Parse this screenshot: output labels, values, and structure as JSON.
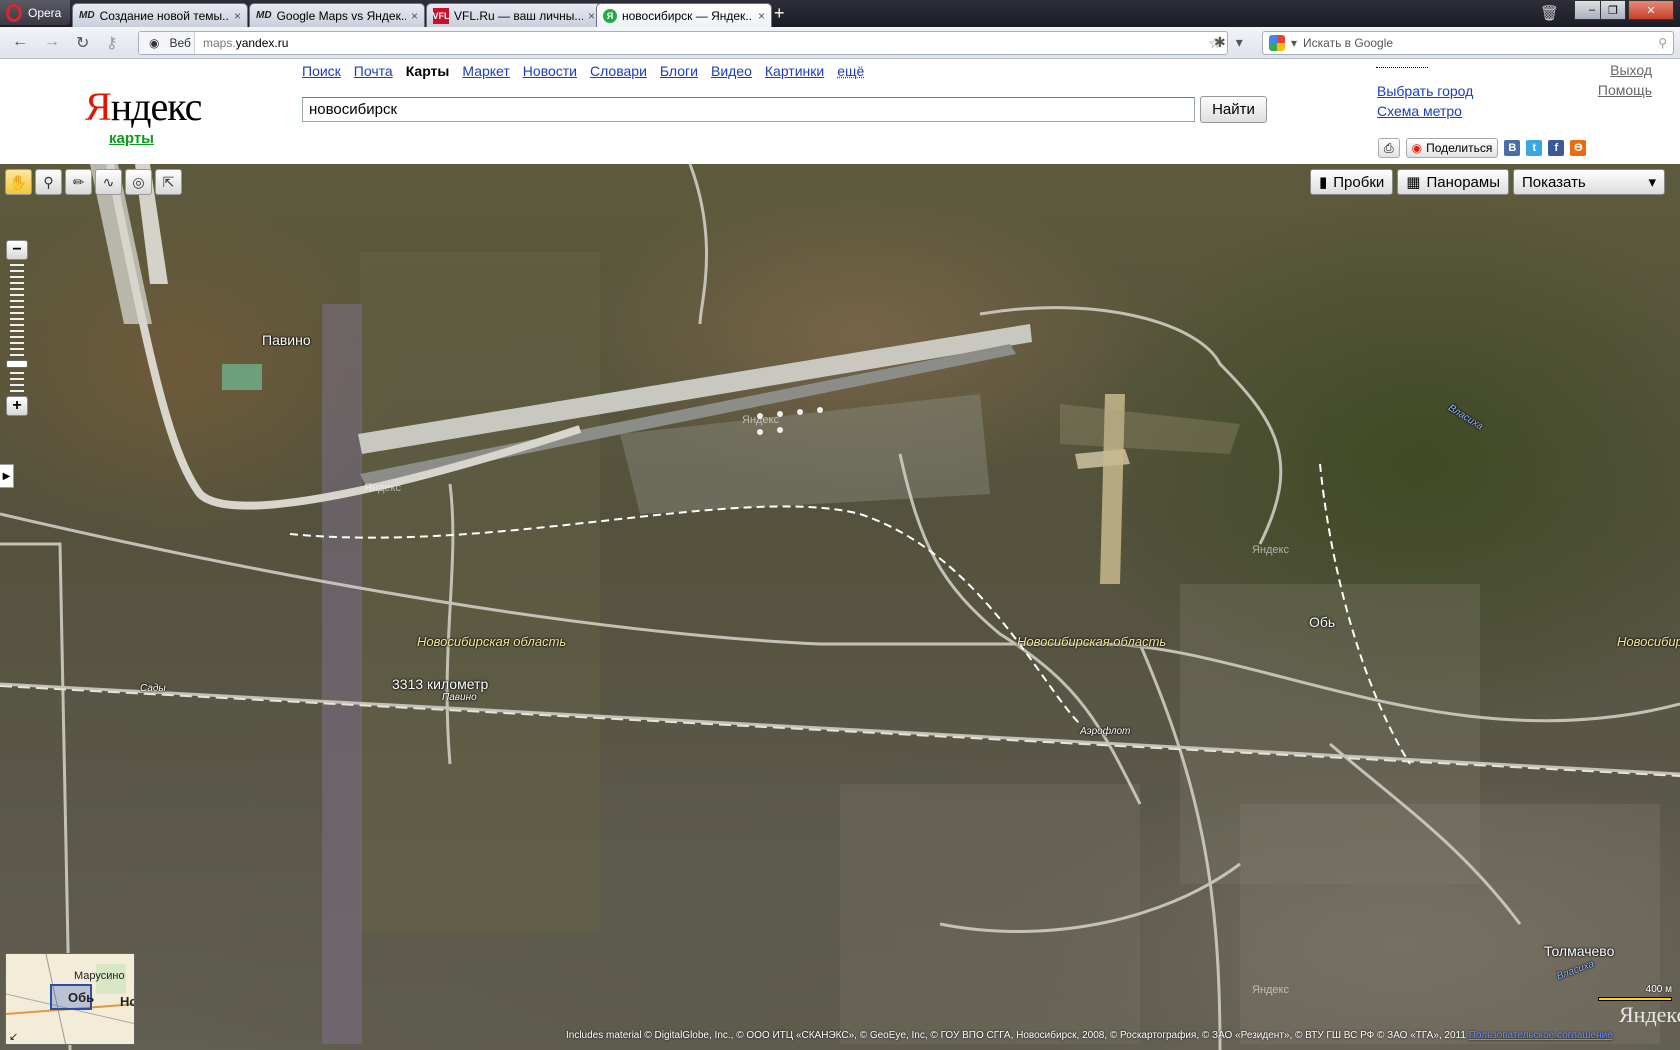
{
  "browser": {
    "menu_label": "Opera",
    "tabs": [
      {
        "icon": "MD",
        "title": "Создание новой темы...",
        "close": "×"
      },
      {
        "icon": "MD",
        "title": "Google Maps vs Яндек...",
        "close": "×"
      },
      {
        "icon": "VFL",
        "title": "VFL.Ru — ваш личны...",
        "close": "×"
      },
      {
        "icon": "Я",
        "title": "новосибирск — Яндек...",
        "close": "×"
      }
    ],
    "new_tab": "+",
    "web_label": "Веб",
    "url_host": "maps.",
    "url_domain": "yandex.ru",
    "search_placeholder": "Искать в Google"
  },
  "header": {
    "logo_y": "Я",
    "logo_rest": "ндекс",
    "service": "карты",
    "nav": [
      "Поиск",
      "Почта",
      "Карты",
      "Маркет",
      "Новости",
      "Словари",
      "Блоги",
      "Видео",
      "Картинки",
      "ещё"
    ],
    "query": "новосибирск",
    "find_button": "Найти",
    "links": [
      "Выбрать город",
      "Схема метро"
    ],
    "right_links": [
      "Выход",
      "Помощь"
    ],
    "share": "Поделиться"
  },
  "map": {
    "buttons": {
      "traffic": "Пробки",
      "panoramas": "Панорамы",
      "show": "Показать"
    },
    "labels": {
      "pavino": "Павино",
      "yandex1": "Яндекс",
      "yandex2": "Яндекс",
      "obl1": "Новосибирская область",
      "obl2": "Новосибирская область",
      "obl3": "Новосибирс",
      "km": "3313 километр",
      "sady": "Сады",
      "pavino_st": "Павино",
      "aeroflot": "Аэрофлот",
      "ob": "Обь",
      "tolmachevo": "Толмачево",
      "vlaskha1": "Власиха",
      "vlaskha2": "Власиха",
      "yandex3": "Яндекс",
      "yandex4": "Яндекс"
    },
    "minimap": {
      "label1": "Марусино",
      "label2": "Обь",
      "label3": "Но"
    },
    "scale": "400 м",
    "watermark": "Яндекс",
    "copyright": "Includes material © DigitalGlobe, Inc., © ООО ИТЦ «СКАНЭКС», © GeoEye, Inc, © ГОУ ВПО СГГА, Новосибирск, 2008, © Роскартография, © ЗАО «Резидент», © ВТУ ГШ ВС РФ © ЗАО «ТГА», 2011",
    "terms": "Пользовательское соглашение"
  }
}
